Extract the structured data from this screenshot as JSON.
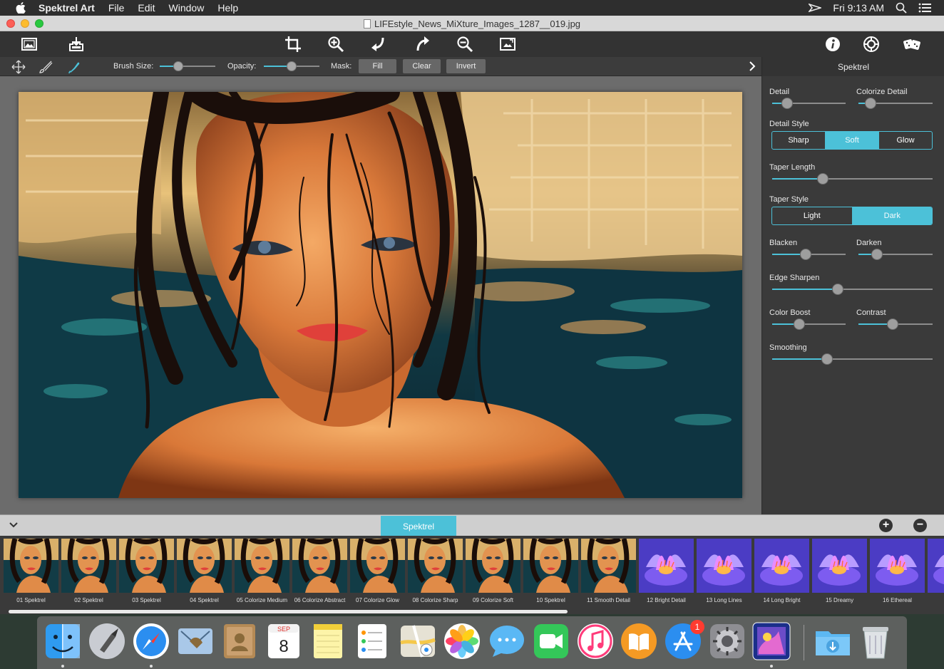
{
  "menubar": {
    "app_name": "Spektrel Art",
    "items": [
      "File",
      "Edit",
      "Window",
      "Help"
    ],
    "clock": "Fri 9:13 AM"
  },
  "window": {
    "title": "LIFEstyle_News_MiXture_Images_1287__019.jpg"
  },
  "toolbar": {
    "icons": [
      "open-image-icon",
      "save-image-icon",
      "crop-icon",
      "zoom-in-icon",
      "undo-icon",
      "redo-icon",
      "zoom-out-icon",
      "fit-image-icon",
      "info-icon",
      "settings-icon",
      "random-dice-icon"
    ]
  },
  "brushbar": {
    "brush_size_label": "Brush Size:",
    "brush_size_value": 0.3,
    "opacity_label": "Opacity:",
    "opacity_value": 0.5,
    "mask_label": "Mask:",
    "fill_label": "Fill",
    "clear_label": "Clear",
    "invert_label": "Invert"
  },
  "panel": {
    "title": "Spektrel",
    "detail_label": "Detail",
    "detail_value": 0.15,
    "colorize_detail_label": "Colorize Detail",
    "colorize_detail_value": 0.1,
    "detail_style_label": "Detail Style",
    "detail_style_options": [
      "Sharp",
      "Soft",
      "Glow"
    ],
    "detail_style_selected": "Soft",
    "taper_length_label": "Taper Length",
    "taper_length_value": 0.3,
    "taper_style_label": "Taper Style",
    "taper_style_options": [
      "Light",
      "Dark"
    ],
    "taper_style_selected": "Dark",
    "blacken_label": "Blacken",
    "blacken_value": 0.45,
    "darken_label": "Darken",
    "darken_value": 0.2,
    "edge_sharpen_label": "Edge Sharpen",
    "edge_sharpen_value": 0.4,
    "color_boost_label": "Color Boost",
    "color_boost_value": 0.35,
    "contrast_label": "Contrast",
    "contrast_value": 0.45,
    "smoothing_label": "Smoothing",
    "smoothing_value": 0.33
  },
  "presets": {
    "tab_label": "Spektrel",
    "add_label": "+",
    "remove_label": "−",
    "items": [
      {
        "label": "01 Spektrel",
        "kind": "portrait"
      },
      {
        "label": "02 Spektrel",
        "kind": "portrait"
      },
      {
        "label": "03 Spektrel",
        "kind": "portrait"
      },
      {
        "label": "04 Spektrel",
        "kind": "portrait"
      },
      {
        "label": "05 Colorize Medium",
        "kind": "portrait"
      },
      {
        "label": "06 Colorize Abstract",
        "kind": "portrait"
      },
      {
        "label": "07 Colorize Glow",
        "kind": "portrait"
      },
      {
        "label": "08 Colorize Sharp",
        "kind": "portrait"
      },
      {
        "label": "09 Colorize Soft",
        "kind": "portrait"
      },
      {
        "label": "10 Spektrel",
        "kind": "portrait"
      },
      {
        "label": "11 Smooth Detail",
        "kind": "portrait"
      },
      {
        "label": "12 Bright Detail",
        "kind": "flower"
      },
      {
        "label": "13 Long Lines",
        "kind": "flower"
      },
      {
        "label": "14 Long Bright",
        "kind": "flower"
      },
      {
        "label": "15 Dreamy",
        "kind": "flower"
      },
      {
        "label": "16 Ethereal",
        "kind": "flower"
      },
      {
        "label": "17 E",
        "kind": "flower"
      }
    ]
  },
  "dock": {
    "apps": [
      "finder-icon",
      "launchpad-icon",
      "safari-icon",
      "mail-icon",
      "contacts-icon",
      "calendar-icon",
      "notes-icon",
      "reminders-icon",
      "maps-icon",
      "photos-icon",
      "messages-icon",
      "facetime-icon",
      "itunes-icon",
      "ibooks-icon",
      "app-store-icon",
      "system-preferences-icon",
      "spektrel-art-icon",
      "downloads-folder-icon",
      "trash-icon"
    ],
    "calendar_month": "SEP",
    "calendar_day": "8",
    "app_store_badge": "1"
  }
}
